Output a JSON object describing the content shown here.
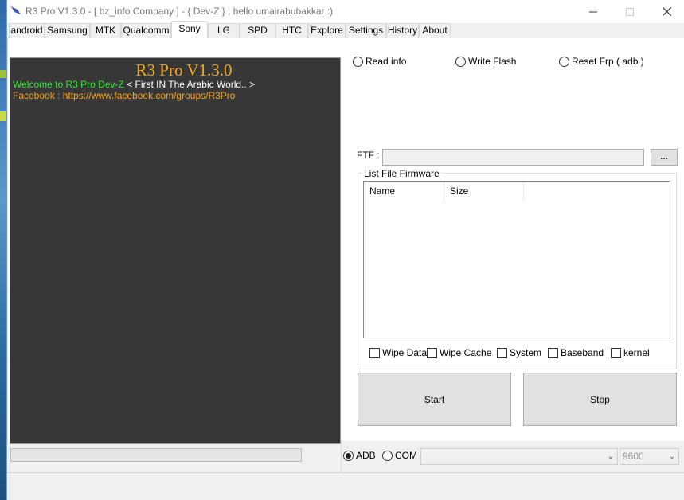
{
  "window": {
    "title": "R3 Pro V1.3.0 - [ bz_info Company ] - { Dev-Z } , hello umairabubakkar :)"
  },
  "tabs": [
    {
      "label": "android"
    },
    {
      "label": "Samsung"
    },
    {
      "label": "MTK"
    },
    {
      "label": "Qualcomm"
    },
    {
      "label": "Sony"
    },
    {
      "label": "LG"
    },
    {
      "label": "SPD"
    },
    {
      "label": "HTC"
    },
    {
      "label": "Explore"
    },
    {
      "label": "Settings"
    },
    {
      "label": "History"
    },
    {
      "label": "About"
    }
  ],
  "active_tab": "Sony",
  "console": {
    "title": "R3 Pro V1.3.0",
    "welcome": "Welcome to R3 Pro Dev-Z",
    "tagline": " < First IN The Arabic World.. >",
    "facebook": "Facebook : https://www.facebook.com/groups/R3Pro"
  },
  "operations": {
    "read_info": "Read info",
    "write_flash": "Write Flash",
    "reset_frp": "Reset Frp ( adb )"
  },
  "ftf": {
    "label": "FTF :",
    "value": "",
    "browse": "..."
  },
  "firmware_list": {
    "group_label": "List File Firmware",
    "columns": [
      "Name",
      "Size"
    ]
  },
  "options": {
    "wipe_data": "Wipe Data",
    "wipe_cache": "Wipe Cache",
    "system": "System",
    "baseband": "Baseband",
    "kernel": "kernel"
  },
  "actions": {
    "start": "Start",
    "stop": "Stop"
  },
  "connection": {
    "adb": "ADB",
    "com": "COM",
    "selected": "ADB",
    "port": "",
    "baud": "9600"
  },
  "progress": 0,
  "colors": {
    "console_bg": "#373737",
    "console_title": "#f5a623",
    "console_green": "#3be23b",
    "console_orange": "#f5a623"
  }
}
